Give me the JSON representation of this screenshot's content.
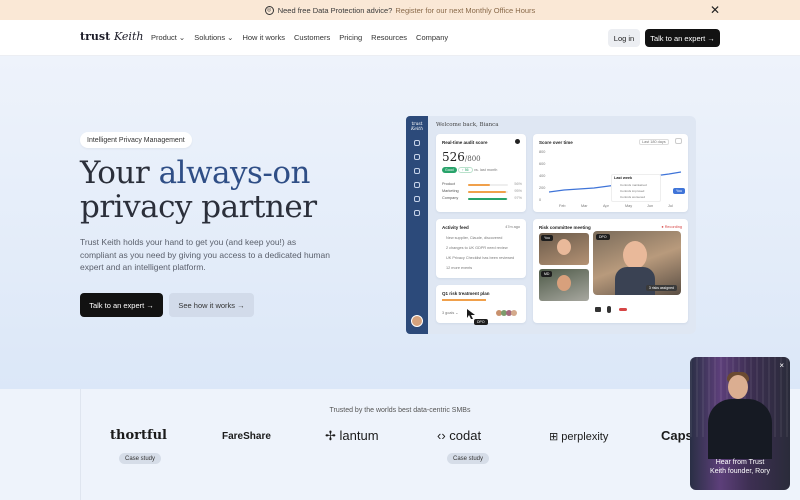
{
  "announcement": {
    "text": "Need free Data Protection advice?",
    "link": "Register for our next Monthly Office Hours"
  },
  "nav": {
    "logo_a": "trust",
    "logo_b": "Keith",
    "menu": [
      "Product ⌄",
      "Solutions ⌄",
      "How it works",
      "Customers",
      "Pricing",
      "Resources",
      "Company"
    ],
    "login": "Log in",
    "cta": "Talk to an expert →"
  },
  "hero": {
    "badge": "Intelligent Privacy Management",
    "headline_1": "Your ",
    "headline_accent": "always-on",
    "headline_2": "privacy partner",
    "subtext": "Trust Keith holds your hand to get you (and keep you!) as compliant as you need by giving you access to a dedicated human expert and an intelligent platform.",
    "cta_primary": "Talk to an expert →",
    "cta_secondary": "See how it works →"
  },
  "dashboard": {
    "welcome": "Welcome back, Bianca",
    "audit": {
      "title": "Real-time audit score",
      "score": "526",
      "max": "/800",
      "status": "Good",
      "delta": "↑ 56",
      "delta_note": "vs. last month",
      "rows": [
        {
          "label": "Product",
          "pct": "56%",
          "fill": 0.56,
          "color": "#f0a04b"
        },
        {
          "label": "Marketing",
          "pct": "95%",
          "fill": 0.95,
          "color": "#f0a04b"
        },
        {
          "label": "Company",
          "pct": "97%",
          "fill": 0.97,
          "color": "#28a36a"
        }
      ]
    },
    "score_over_time": {
      "title": "Score over time",
      "range": "Last 180 days",
      "y_ticks": [
        "800",
        "600",
        "400",
        "200",
        "0"
      ],
      "x_ticks": [
        "Feb",
        "Mar",
        "Apr",
        "May",
        "Jun",
        "Jul"
      ],
      "last_week": "Last week",
      "legend": [
        "Controls maintained",
        "Controls improved",
        "Controls worsened"
      ],
      "you": "You"
    },
    "activity": {
      "title": "Activity feed",
      "time": "47m ago",
      "items": [
        "New supplier, Claude, discovered",
        "2 changes to UK GDPR need review",
        "UK Privacy Checklist has been reviewed",
        "12 more events"
      ]
    },
    "plan": {
      "title": "Q1 risk treatment plan",
      "goals": "3 goals ⌄",
      "dpo": "DPO"
    },
    "meeting": {
      "title": "Risk committee meeting",
      "recording": "● Recording",
      "dpo": "DPO",
      "you": "You",
      "md": "MD",
      "risks": "3 risks assigned"
    }
  },
  "trusted": {
    "title": "Trusted by the worlds best data-centric SMBs",
    "brands": [
      "thortful",
      "FareShare",
      "lantum",
      "codat",
      "perplexity",
      "Caps"
    ],
    "case_label": "Case study"
  },
  "video": {
    "caption_1": "Hear from Trust",
    "caption_2": "Keith founder, Rory",
    "close": "×"
  },
  "colors": {
    "accent": "#2f4e86",
    "dark": "#121212",
    "banner": "#fae8d6",
    "hero_bg": "#e3ecf9"
  }
}
